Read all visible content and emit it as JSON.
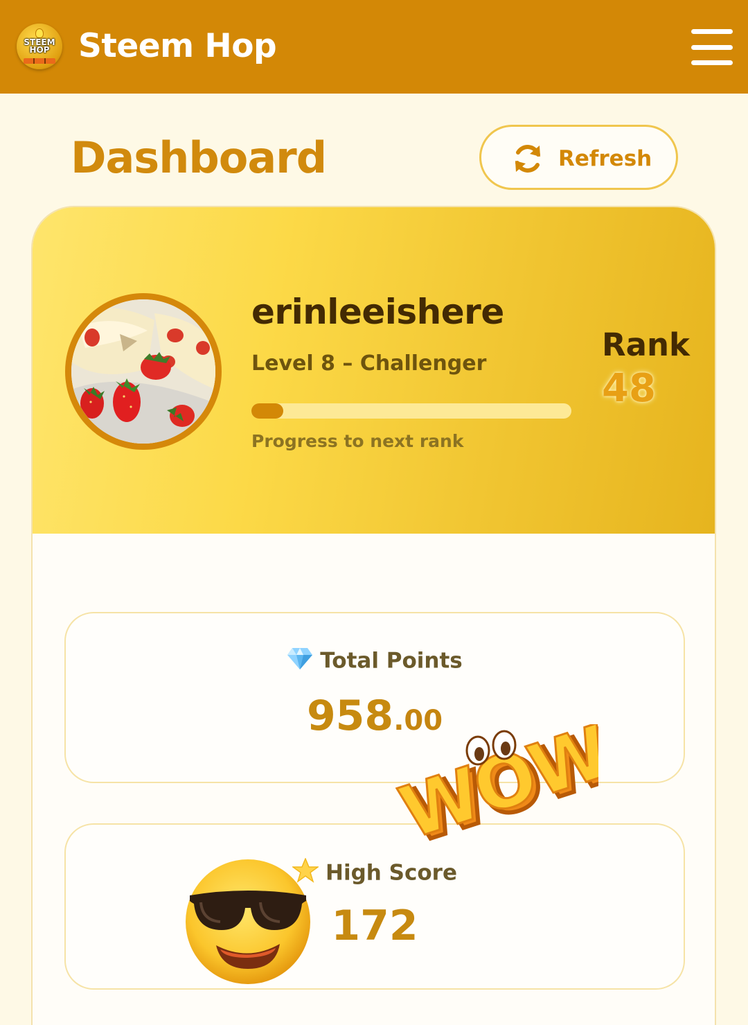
{
  "header": {
    "app_title": "Steem Hop",
    "logo_text_line1": "STEEM",
    "logo_text_line2": "HOP"
  },
  "page": {
    "title": "Dashboard",
    "refresh_label": "Refresh"
  },
  "profile": {
    "username": "erinleeishere",
    "level": "Level 8 – Challenger",
    "progress_label": "Progress to next rank",
    "progress_fraction": 0.1,
    "rank_label": "Rank",
    "rank_value": "48"
  },
  "stats": {
    "total_points": {
      "label": "Total Points",
      "value_int": "958",
      "value_dec": ".00",
      "icon": "diamond-icon"
    },
    "high_score": {
      "label": "High Score",
      "value": "172",
      "icon": "star-icon"
    }
  },
  "stickers": {
    "wow_text": "WOW",
    "emoji": "sunglasses-emoji"
  },
  "colors": {
    "header": "#d38806",
    "background": "#fef9e6",
    "accent": "#d18a0d",
    "banner_light": "#fee56c",
    "banner_dark": "#e6b41e"
  }
}
